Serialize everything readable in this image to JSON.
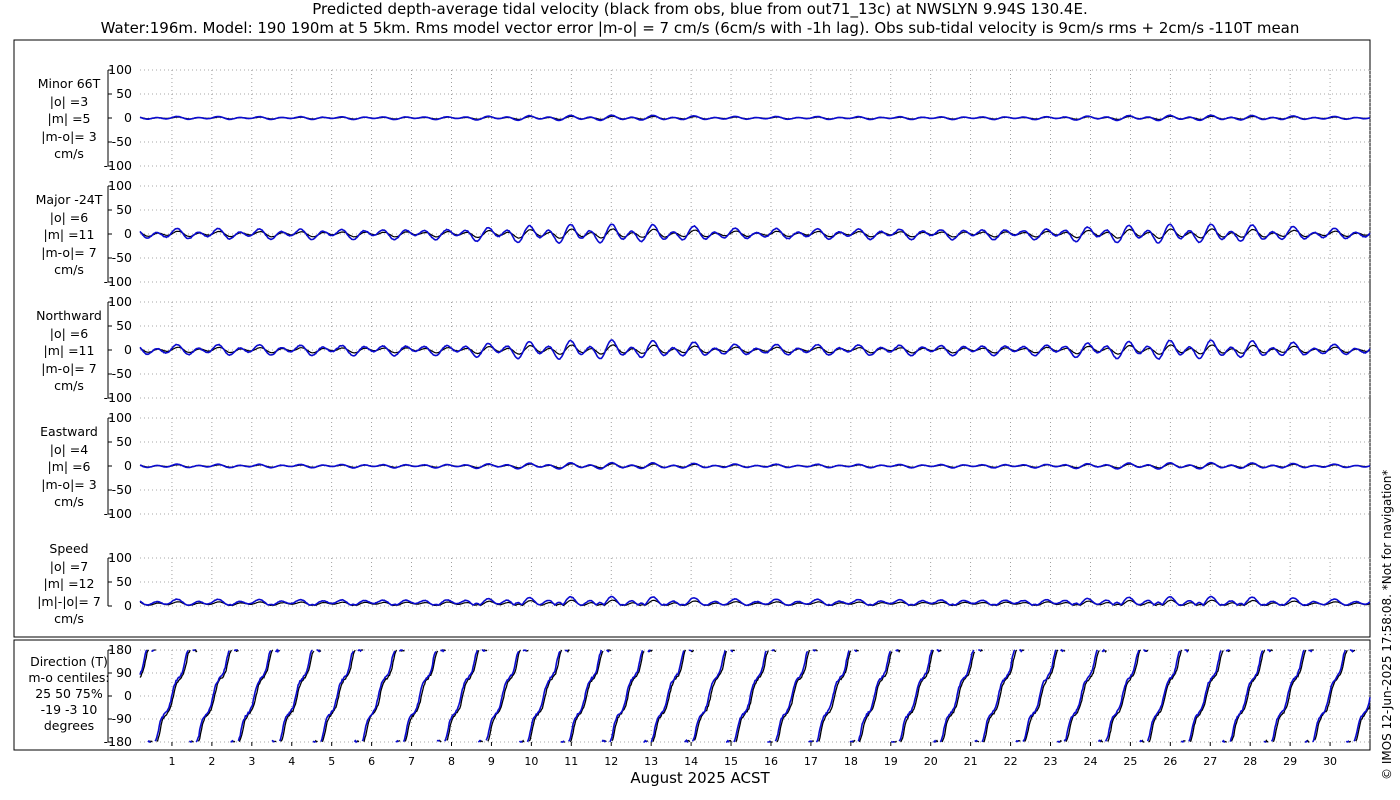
{
  "header": {
    "title_line1": "Predicted depth-average tidal velocity (black from obs, blue from out71_13c) at NWSLYN 9.94S 130.4E.",
    "title_line2": "Water:196m. Model: 190 190m at 5 5km. Rms model vector error |m-o| = 7 cm/s (6cm/s with -1h lag). Obs sub-tidal velocity is 9cm/s rms + 2cm/s -110T mean"
  },
  "xlabel": "August 2025 ACST",
  "credit": "© IMOS 12-Jun-2025 17:58:08. *Not for navigation*",
  "colors": {
    "obs": "#000000",
    "model": "#0b0bd0",
    "grid": "#8a8a8a"
  },
  "chart_data": [
    {
      "type": "line",
      "panel": "minor",
      "label_lines": [
        "Minor 66T",
        "|o| =3",
        "|m| =5",
        "|m-o|= 3",
        "cm/s"
      ],
      "ylim": [
        -100,
        100
      ],
      "yticks": [
        100,
        50,
        0,
        -50,
        -100
      ],
      "xlim": [
        0.2,
        31
      ],
      "grid": true,
      "series": [
        {
          "role": "obs",
          "amplitude": 3,
          "offset": 0
        },
        {
          "role": "model",
          "amplitude": 5,
          "offset": 0
        }
      ]
    },
    {
      "type": "line",
      "panel": "major",
      "label_lines": [
        "Major -24T",
        "|o| =6",
        "|m| =11",
        "|m-o|= 7",
        "cm/s"
      ],
      "ylim": [
        -100,
        100
      ],
      "yticks": [
        100,
        50,
        0,
        -50,
        -100
      ],
      "xlim": [
        0.2,
        31
      ],
      "grid": true,
      "series": [
        {
          "role": "obs",
          "amplitude": 9,
          "offset": 0
        },
        {
          "role": "model",
          "amplitude": 18,
          "offset": 0
        }
      ]
    },
    {
      "type": "line",
      "panel": "northward",
      "label_lines": [
        "Northward",
        "|o| =6",
        "|m| =11",
        "|m-o|= 7",
        "cm/s"
      ],
      "ylim": [
        -100,
        100
      ],
      "yticks": [
        100,
        50,
        0,
        -50,
        -100
      ],
      "xlim": [
        0.2,
        31
      ],
      "grid": true,
      "series": [
        {
          "role": "obs",
          "amplitude": 9,
          "offset": 0
        },
        {
          "role": "model",
          "amplitude": 18,
          "offset": 0
        }
      ]
    },
    {
      "type": "line",
      "panel": "eastward",
      "label_lines": [
        "Eastward",
        "|o| =4",
        "|m| =6",
        "|m-o|= 3",
        "cm/s"
      ],
      "ylim": [
        -100,
        100
      ],
      "yticks": [
        100,
        50,
        0,
        -50,
        -100
      ],
      "xlim": [
        0.2,
        31
      ],
      "grid": true,
      "series": [
        {
          "role": "obs",
          "amplitude": 4,
          "offset": 0
        },
        {
          "role": "model",
          "amplitude": 6,
          "offset": 0
        }
      ]
    },
    {
      "type": "line",
      "panel": "speed",
      "label_lines": [
        "Speed",
        "|o| =7",
        "|m| =12",
        "|m|-|o|= 7",
        "cm/s"
      ],
      "ylim": [
        0,
        100
      ],
      "yticks": [
        100,
        50,
        0
      ],
      "xlim": [
        0.2,
        31
      ],
      "grid": true,
      "series": [
        {
          "role": "obs",
          "amplitude": 7,
          "offset": 4
        },
        {
          "role": "model",
          "amplitude": 12,
          "offset": 6
        }
      ]
    },
    {
      "type": "line",
      "panel": "direction",
      "label_lines": [
        "Direction (T)",
        "m-o centiles:",
        "25  50  75%",
        "-19  -3  10",
        "degrees"
      ],
      "ylim": [
        -180,
        180
      ],
      "yticks": [
        180,
        90,
        0,
        -90,
        -180
      ],
      "xlim": [
        0.2,
        31
      ],
      "grid": true,
      "wrapped": true,
      "series": [
        {
          "role": "obs"
        },
        {
          "role": "model"
        }
      ]
    }
  ],
  "x_ticks": [
    "1",
    "2",
    "3",
    "4",
    "5",
    "6",
    "7",
    "8",
    "9",
    "10",
    "11",
    "12",
    "13",
    "14",
    "15",
    "16",
    "17",
    "18",
    "19",
    "20",
    "21",
    "22",
    "23",
    "24",
    "25",
    "26",
    "27",
    "28",
    "29",
    "30"
  ]
}
